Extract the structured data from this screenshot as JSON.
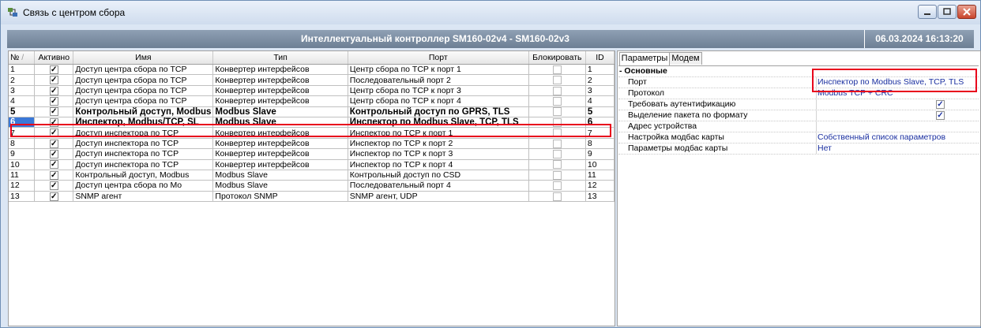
{
  "window": {
    "title": "Связь с центром сбора"
  },
  "header": {
    "device": "Интеллектуальный контроллер SM160-02v4 - SM160-02v3",
    "datetime": "06.03.2024 16:13:20"
  },
  "grid": {
    "columns": [
      "№",
      "Активно",
      "Имя",
      "Тип",
      "Порт",
      "Блокировать",
      "ID"
    ],
    "rows": [
      {
        "num": "1",
        "name": "Доступ центра сбора по TCP",
        "type": "Конвертер интерфейсов",
        "port": "Центр сбора по TCP к порт 1",
        "id": "1"
      },
      {
        "num": "2",
        "name": "Доступ центра сбора по TCP",
        "type": "Конвертер интерфейсов",
        "port": "Последовательный порт 2",
        "id": "2"
      },
      {
        "num": "3",
        "name": "Доступ центра сбора по TCP",
        "type": "Конвертер интерфейсов",
        "port": "Центр сбора по TCP к порт 3",
        "id": "3"
      },
      {
        "num": "4",
        "name": "Доступ центра сбора по TCP",
        "type": "Конвертер интерфейсов",
        "port": "Центр сбора по TCP к порт 4",
        "id": "4"
      },
      {
        "num": "5",
        "name": "Контрольный доступ, Modbus",
        "type": "Modbus Slave",
        "port": "Контрольный доступ по GPRS, TLS",
        "id": "5"
      },
      {
        "num": "6",
        "name": "Инспектор, Modbus/TCP, SL",
        "type": "Modbus Slave",
        "port": "Инспектор по Modbus Slave, TCP, TLS",
        "id": "6"
      },
      {
        "num": "7",
        "name": "Доступ инспектора по TCP",
        "type": "Конвертер интерфейсов",
        "port": "Инспектор по TCP к порт 1",
        "id": "7"
      },
      {
        "num": "8",
        "name": "Доступ инспектора по TCP",
        "type": "Конвертер интерфейсов",
        "port": "Инспектор по TCP к порт 2",
        "id": "8"
      },
      {
        "num": "9",
        "name": "Доступ инспектора по TCP",
        "type": "Конвертер интерфейсов",
        "port": "Инспектор по TCP к порт 3",
        "id": "9"
      },
      {
        "num": "10",
        "name": "Доступ инспектора по TCP",
        "type": "Конвертер интерфейсов",
        "port": "Инспектор по TCP к порт 4",
        "id": "10"
      },
      {
        "num": "11",
        "name": "Контрольный доступ, Modbus",
        "type": "Modbus Slave",
        "port": "Контрольный доступ по CSD",
        "id": "11"
      },
      {
        "num": "12",
        "name": "Доступ центра сбора по Mo",
        "type": "Modbus Slave",
        "port": "Последовательный порт 4",
        "id": "12"
      },
      {
        "num": "13",
        "name": "SNMP агент",
        "type": "Протокол SNMP",
        "port": "SNMP агент, UDP",
        "id": "13"
      }
    ]
  },
  "tabs": [
    "Параметры",
    "Модем"
  ],
  "properties": {
    "section": "- Основные",
    "rows": [
      {
        "name": "Порт",
        "value": "Инспектор по Modbus Slave, TCP, TLS"
      },
      {
        "name": "Протокол",
        "value": "Modbus TCP + CRC"
      },
      {
        "name": "Требовать аутентификацию",
        "value": ""
      },
      {
        "name": "Выделение пакета по формату",
        "value": ""
      },
      {
        "name": "Адрес устройства",
        "value": ""
      },
      {
        "name": "Настройка модбас карты",
        "value": "Собственный список параметров"
      },
      {
        "name": "Параметры модбас карты",
        "value": "Нет"
      }
    ]
  }
}
